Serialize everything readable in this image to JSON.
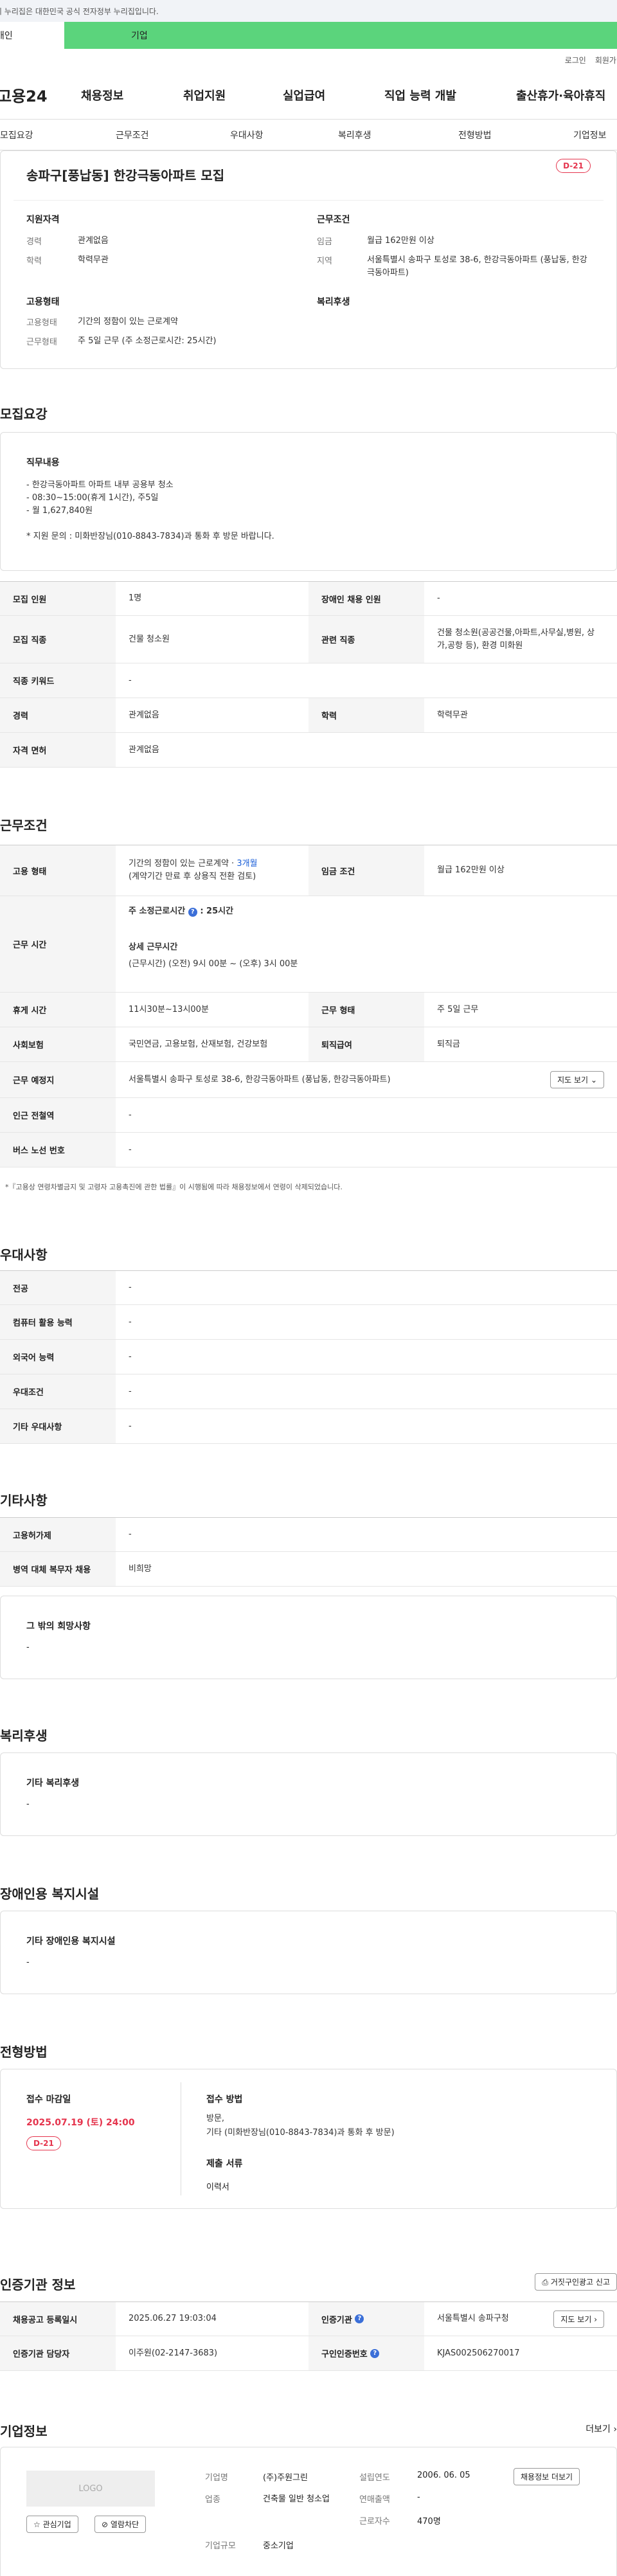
{
  "gov_banner": "이 누리집은 대한민국 공식 전자정부 누리집입니다.",
  "sector_tabs": [
    "개인",
    "기업"
  ],
  "util": [
    "로그인",
    "회원가입"
  ],
  "logo": "고용24",
  "gnb": [
    "채용정보",
    "취업지원",
    "실업급여",
    "직업 능력 개발",
    "출산휴가·육아휴직"
  ],
  "subnav": [
    "모집요강",
    "근무조건",
    "우대사항",
    "복리후생",
    "전형방법",
    "기업정보"
  ],
  "job": {
    "title": "송파구[풍납동] 한강극동아파트 모집",
    "dday": "D-21"
  },
  "summary": {
    "qual_h": "지원자격",
    "cond_h": "근무조건",
    "emp_h": "고용형태",
    "welfare_h": "복리후생",
    "career_k": "경력",
    "career_v": "관계없음",
    "edu_k": "학력",
    "edu_v": "학력무관",
    "wage_k": "임금",
    "wage_v": "월급 162만원 이상",
    "area_k": "지역",
    "area_v": "서울특별시 송파구 토성로 38-6, 한강극동아파트 (풍납동, 한강극동아파트)",
    "etype_k": "고용형태",
    "etype_v": "기간의 정함이 있는 근로계약",
    "wtype_k": "근무형태",
    "wtype_v": "주 5일 근무 (주 소정근로시간: 25시간)"
  },
  "recruit": {
    "title": "모집요강",
    "duty_h": "직무내용",
    "duty_lines": [
      "- 한강극동아파트 아파트 내부 공용부 청소",
      "- 08:30~15:00(휴게 1시간), 주5일",
      "- 월 1,627,840원",
      "",
      "* 지원 문의 : 미화반장님(010-8843-7834)과 통화 후 방문 바랍니다."
    ],
    "rows": [
      {
        "h1": "모집 인원",
        "v1": "1명",
        "h2": "장애인 채용 인원",
        "v2": "-"
      },
      {
        "h1": "모집 직종",
        "v1": "건물 청소원",
        "h2": "관련 직종",
        "v2": "건물 청소원(공공건물,아파트,사무실,병원, 상가,공항 등), 환경 미화원"
      },
      {
        "h1": "직종 키워드",
        "v1": "-",
        "h2": "",
        "v2": ""
      },
      {
        "h1": "경력",
        "v1": "관계없음",
        "h2": "학력",
        "v2": "학력무관"
      },
      {
        "h1": "자격 면허",
        "v1": "관계없음",
        "h2": "",
        "v2": ""
      }
    ]
  },
  "conditions": {
    "title": "근무조건",
    "emp_h": "고용 형태",
    "emp_v": "기간의 정함이 있는 근로계약 · ",
    "emp_link": "3개월",
    "emp_v2": "(계약기간 만료 후 상용직 전환 검토)",
    "wage_h": "임금 조건",
    "wage_v": "월급 162만원 이상",
    "hours_h": "근무 시간",
    "hours_std": "주 소정근로시간",
    "hours_std_v": ": 25시간",
    "hours_detail_h": "상세 근무시간",
    "hours_detail_v": "(근무시간) (오전) 9시 00분 ~ (오후) 3시 00분",
    "break_h": "휴게 시간",
    "break_v": "11시30분~13시00분",
    "wtype_h": "근무 형태",
    "wtype_v": "주 5일 근무",
    "ins_h": "사회보험",
    "ins_v": "국민연금, 고용보험, 산재보험, 건강보험",
    "sev_h": "퇴직급여",
    "sev_v": "퇴직금",
    "place_h": "근무 예정지",
    "place_v": "서울특별시 송파구 토성로 38-6, 한강극동아파트 (풍납동, 한강극동아파트)",
    "map_btn": "지도 보기",
    "subway_h": "인근 전철역",
    "subway_v": "-",
    "bus_h": "버스 노선 번호",
    "bus_v": "-",
    "note": "*『고용상 연령차별금지 및 고령자 고용촉진에 관한 법률』이 시행됨에 따라 채용정보에서 연령이 삭제되었습니다."
  },
  "pref": {
    "title": "우대사항",
    "rows": [
      [
        "전공",
        "-"
      ],
      [
        "컴퓨터 활용 능력",
        "-"
      ],
      [
        "외국어 능력",
        "-"
      ],
      [
        "우대조건",
        "-"
      ],
      [
        "기타 우대사항",
        "-"
      ]
    ]
  },
  "other": {
    "title": "기타사항",
    "rows": [
      [
        "고용허가제",
        "-"
      ],
      [
        "병역 대체 복무자 채용",
        "비희망"
      ]
    ],
    "wish_h": "그 밖의 희망사항",
    "wish_v": "-"
  },
  "welfare": {
    "title": "복리후생",
    "h": "기타 복리후생",
    "v": "-"
  },
  "disabled": {
    "title": "장애인용 복지시설",
    "h": "기타 장애인용 복지시설",
    "v": "-"
  },
  "process": {
    "title": "전형방법",
    "deadline_h": "접수 마감일",
    "deadline_v": "2025.07.19 (토) 24:00",
    "dday": "D-21",
    "method_h": "접수 방법",
    "method_v1": "방문,",
    "method_v2": "기타 (미화반장님(010-8843-7834)과 통화 후 방문)",
    "docs_h": "제출 서류",
    "docs_v": "이력서"
  },
  "cert": {
    "title": "인증기관 정보",
    "report_btn": "거짓구인광고 신고",
    "reg_h": "채용공고 등록일시",
    "reg_v": "2025.06.27 19:03:04",
    "org_h": "인증기관",
    "org_v": "서울특별시 송파구청",
    "map_btn": "지도 보기",
    "staff_h": "인증기관 담당자",
    "staff_v": "이주원(02-2147-3683)",
    "num_h": "구인인증번호",
    "num_v": "KJAS002506270017"
  },
  "company": {
    "title": "기업정보",
    "more": "더보기",
    "logo": "LOGO",
    "fav_btn": "관심기업",
    "block_btn": "열람차단",
    "name_k": "기업명",
    "name_v": "(주)주원그린",
    "found_k": "설립연도",
    "found_v": "2006. 06. 05",
    "info_btn": "채용정보 더보기",
    "biz_k": "업종",
    "biz_v": "건축물 일반 청소업",
    "sales_k": "연매출액",
    "sales_v": "-",
    "size_k": "기업규모",
    "size_v": "중소기업",
    "emp_k": "근로자수",
    "emp_v": "470명"
  }
}
